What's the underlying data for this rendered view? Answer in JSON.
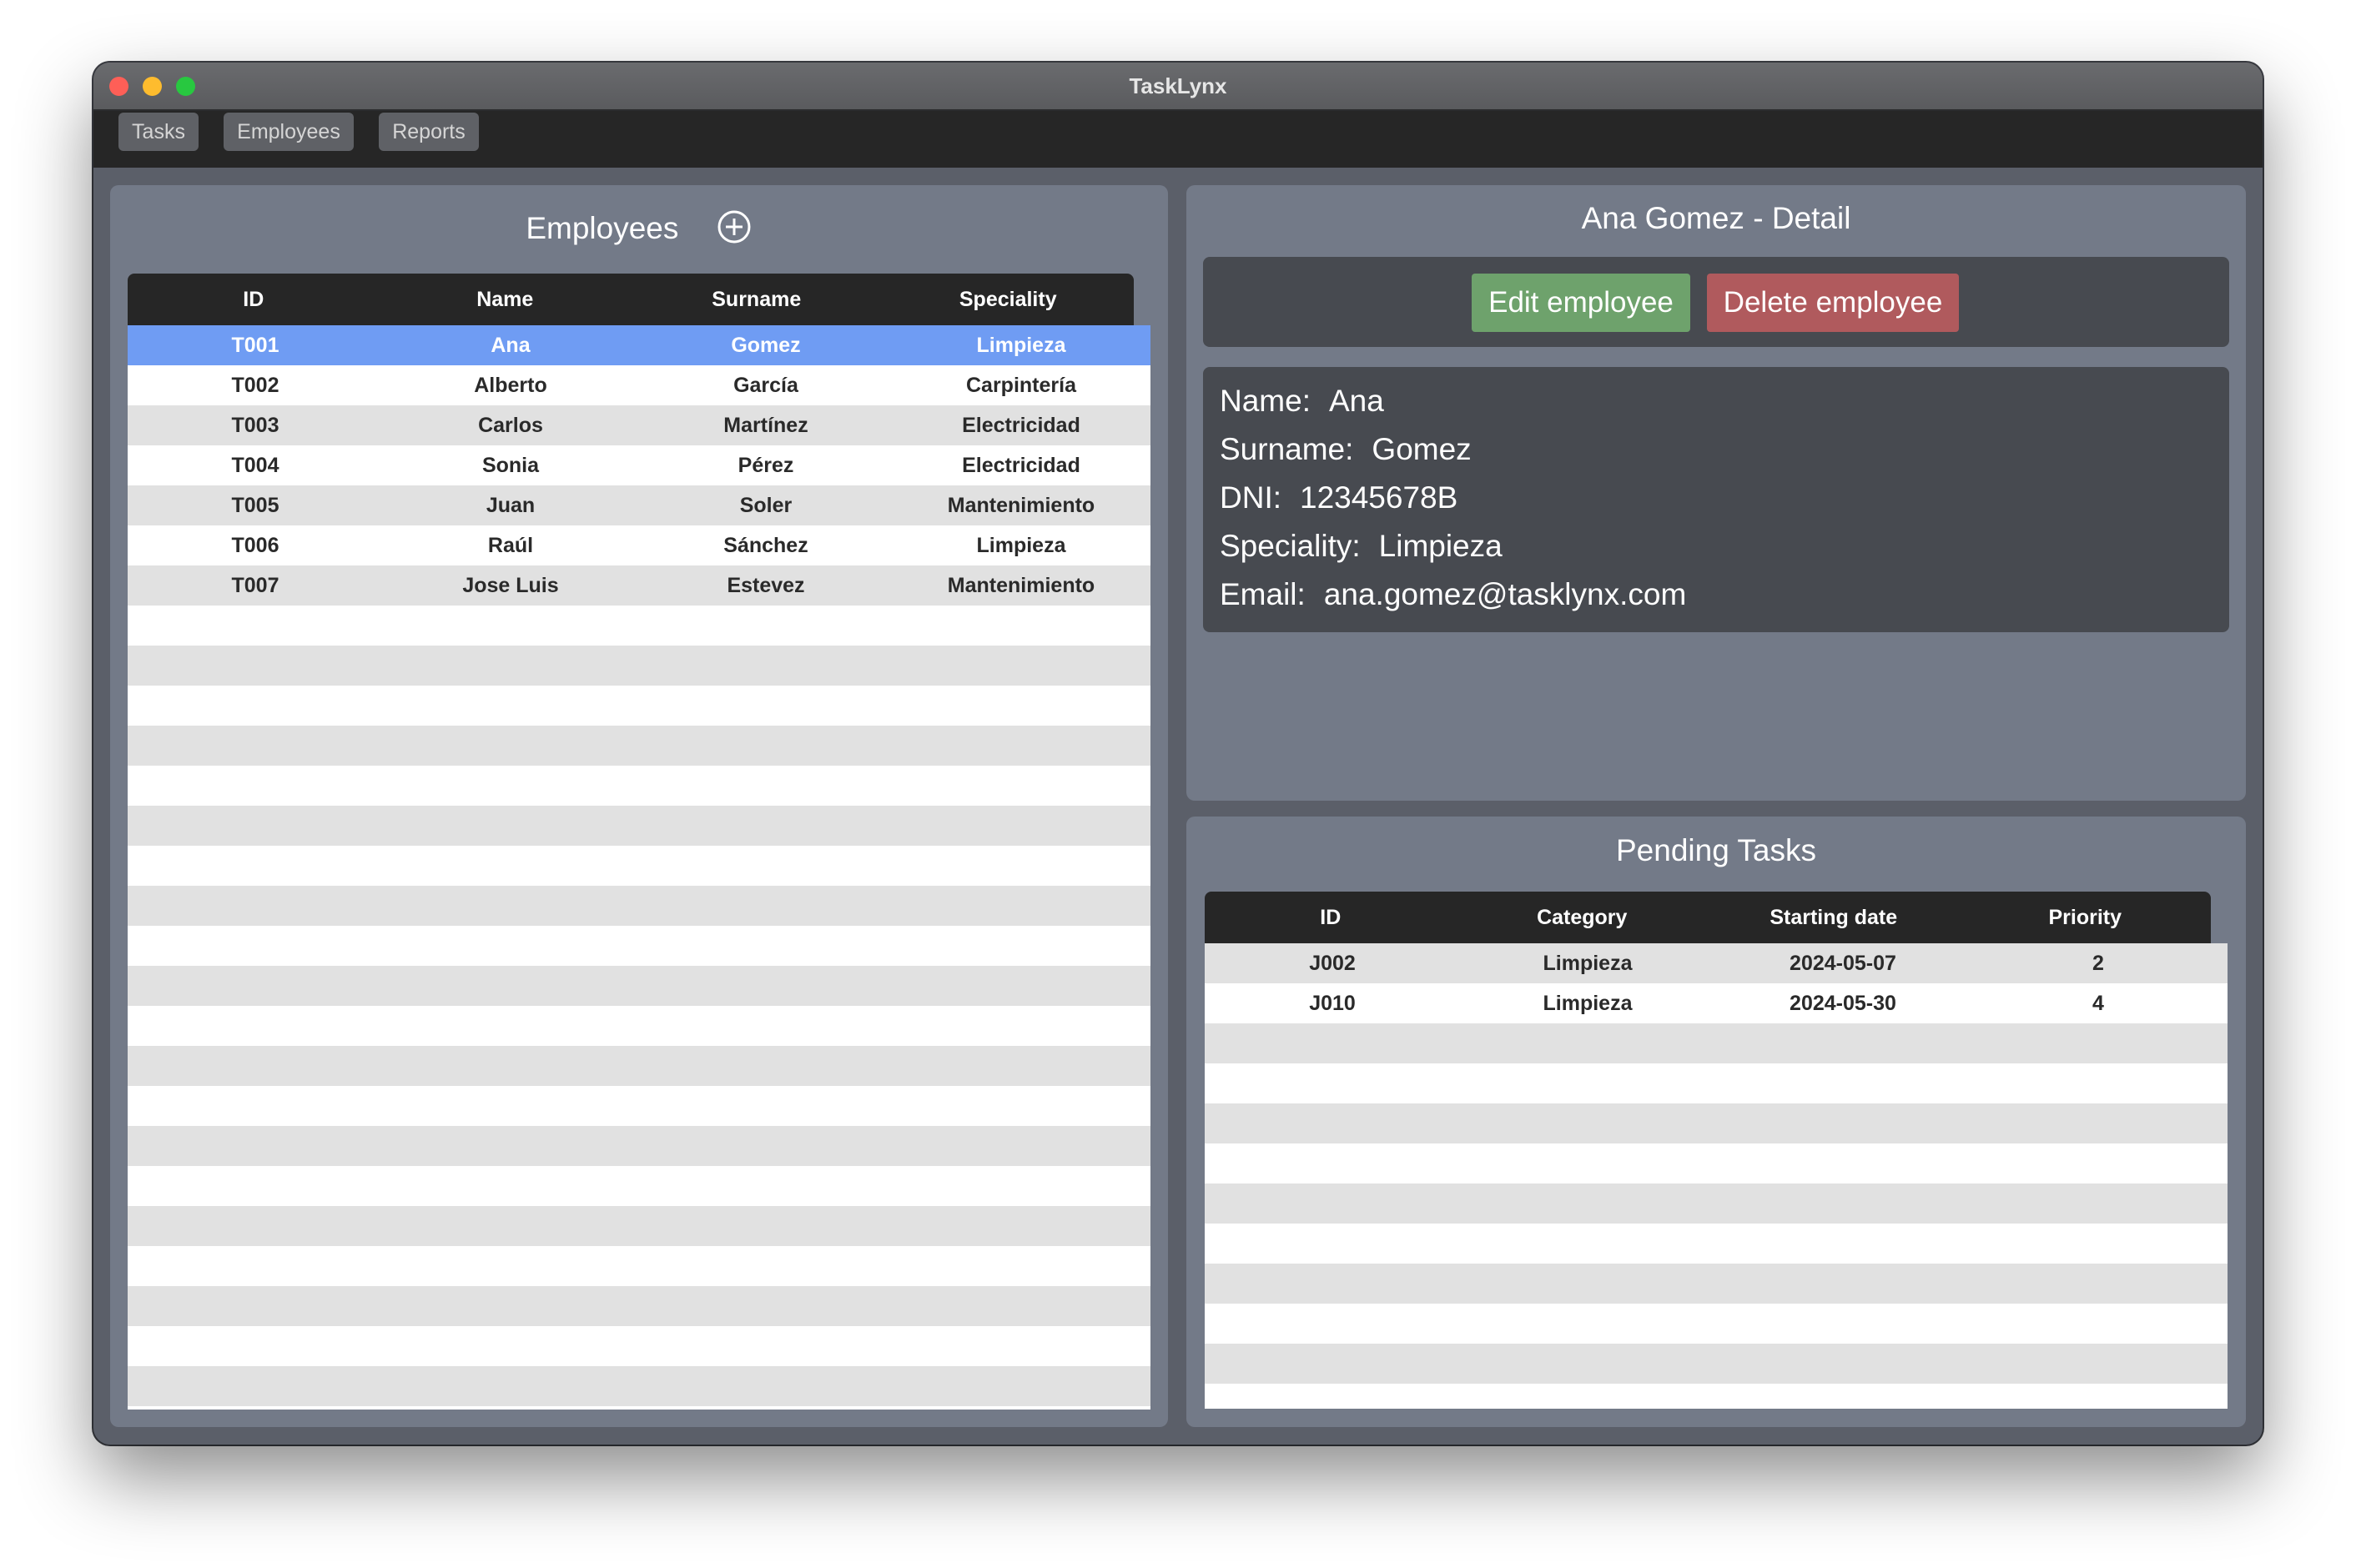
{
  "app": {
    "title": "TaskLynx",
    "nav_tabs": [
      "Tasks",
      "Employees",
      "Reports"
    ]
  },
  "employees_panel": {
    "title": "Employees",
    "add_icon": "plus-circle-icon",
    "columns": [
      "ID",
      "Name",
      "Surname",
      "Speciality"
    ],
    "rows": [
      [
        "T001",
        "Ana",
        "Gomez",
        "Limpieza"
      ],
      [
        "T002",
        "Alberto",
        "García",
        "Carpintería"
      ],
      [
        "T003",
        "Carlos",
        "Martínez",
        "Electricidad"
      ],
      [
        "T004",
        "Sonia",
        "Pérez",
        "Electricidad"
      ],
      [
        "T005",
        "Juan",
        "Soler",
        "Mantenimiento"
      ],
      [
        "T006",
        "Raúl",
        "Sánchez",
        "Limpieza"
      ],
      [
        "T007",
        "Jose Luis",
        "Estevez",
        "Mantenimiento"
      ]
    ],
    "selected_row": 0
  },
  "detail_panel": {
    "title": "Ana Gomez - Detail",
    "edit_label": "Edit employee",
    "delete_label": "Delete employee",
    "fields": [
      {
        "label": "Name:",
        "value": "Ana"
      },
      {
        "label": "Surname:",
        "value": "Gomez"
      },
      {
        "label": "DNI:",
        "value": "12345678B"
      },
      {
        "label": "Speciality:",
        "value": "Limpieza"
      },
      {
        "label": "Email:",
        "value": "ana.gomez@tasklynx.com"
      }
    ]
  },
  "tasks_panel": {
    "title": "Pending Tasks",
    "columns": [
      "ID",
      "Category",
      "Starting date",
      "Priority"
    ],
    "rows": [
      [
        "J002",
        "Limpieza",
        "2024-05-07",
        "2"
      ],
      [
        "J010",
        "Limpieza",
        "2024-05-30",
        "4"
      ]
    ]
  },
  "colors": {
    "accent_selected": "#6f9cf3",
    "edit_button": "#6ea26c",
    "delete_button": "#b05a5d",
    "panel_bg": "#737a88"
  }
}
